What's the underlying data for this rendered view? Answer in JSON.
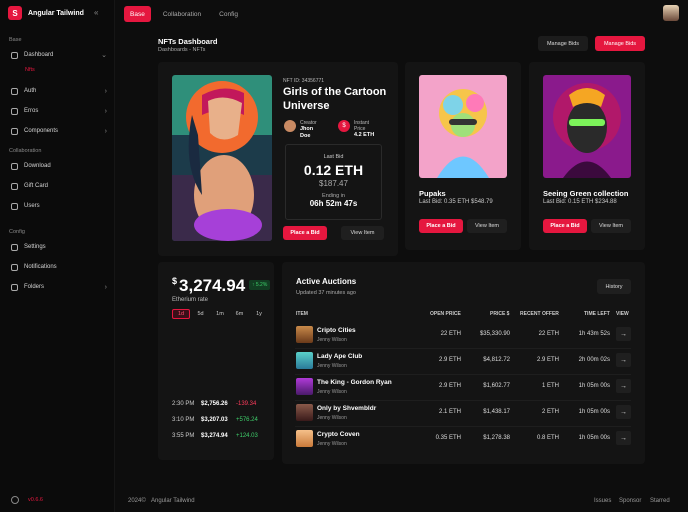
{
  "app": {
    "name": "Angular Tailwind",
    "logo_letter": "S",
    "version": "v0.6.6",
    "accent": "#e5173f"
  },
  "sidebar": {
    "sections": [
      {
        "title": "Base"
      },
      {
        "title": "Collaboration"
      },
      {
        "title": "Config"
      }
    ],
    "items": [
      {
        "label": "Dashboard"
      },
      {
        "label": "Auth"
      },
      {
        "label": "Erros"
      },
      {
        "label": "Components"
      },
      {
        "label": "Download"
      },
      {
        "label": "Gift Card"
      },
      {
        "label": "Users"
      },
      {
        "label": "Settings"
      },
      {
        "label": "Notifications"
      },
      {
        "label": "Folders"
      }
    ],
    "subitem": "Nfts"
  },
  "topbar": {
    "tabs": [
      "Base",
      "Collaboration",
      "Config"
    ]
  },
  "page": {
    "title": "NFTs Dashboard",
    "breadcrumb": "Dashboards  -  NFTs",
    "manage_bids_1": "Manage Bids",
    "manage_bids_2": "Manage Bids"
  },
  "featured": {
    "nft_id": "NFT ID: 34356771",
    "title": "Girls of the Cartoon Universe",
    "creator_label": "Creator",
    "creator_name": "Jhon Doe",
    "price_label": "Instant Price",
    "price_value": "4.2 ETH",
    "last_bid_label": "Last Bid",
    "last_bid_eth": "0.12 ETH",
    "last_bid_usd": "$187.47",
    "ending_label": "Ending in",
    "ending_value": "06h 52m 47s",
    "place_bid": "Place a Bid",
    "view_item": "View Item"
  },
  "cards": [
    {
      "title": "Pupaks",
      "sub": "Last Bid: 0.35 ETH $548.79",
      "place_bid": "Place a Bid",
      "view_item": "View Item"
    },
    {
      "title": "Seeing Green collection",
      "sub": "Last Bid: 0.15 ETH $234.88",
      "place_bid": "Place a Bid",
      "view_item": "View Item"
    }
  ],
  "eth": {
    "currency": "$",
    "price": "3,274.94",
    "change": "↑ 5.2%",
    "label": "Etherium rate",
    "ranges": [
      "1d",
      "5d",
      "1m",
      "6m",
      "1y"
    ],
    "history": [
      {
        "time": "2:30 PM",
        "price": "$2,756.26",
        "change": "-139.34"
      },
      {
        "time": "3:10 PM",
        "price": "$3,207.03",
        "change": "+576.24"
      },
      {
        "time": "3:55 PM",
        "price": "$3,274.94",
        "change": "+124.03"
      }
    ]
  },
  "auctions": {
    "title": "Active Auctions",
    "updated": "Updated 37 minutes ago",
    "history_btn": "History",
    "headers": [
      "ITEM",
      "OPEN PRICE",
      "PRICE $",
      "RECENT OFFER",
      "TIME LEFT",
      "VIEW"
    ],
    "rows": [
      {
        "name": "Cripto Cities",
        "user": "Jenny Wilson",
        "open": "22 ETH",
        "price": "$35,330.90",
        "offer": "22 ETH",
        "time": "1h 43m 52s"
      },
      {
        "name": "Lady Ape Club",
        "user": "Jenny Wilson",
        "open": "2.9 ETH",
        "price": "$4,812.72",
        "offer": "2.9 ETH",
        "time": "2h 00m 02s"
      },
      {
        "name": "The King - Gordon Ryan",
        "user": "Jenny Wilson",
        "open": "2.9 ETH",
        "price": "$1,602.77",
        "offer": "1 ETH",
        "time": "1h 05m 00s"
      },
      {
        "name": "Only by Shvembldr",
        "user": "Jenny Wilson",
        "open": "2.1 ETH",
        "price": "$1,438.17",
        "offer": "2 ETH",
        "time": "1h 05m 00s"
      },
      {
        "name": "Crypto Coven",
        "user": "Jenny Wilson",
        "open": "0.35 ETH",
        "price": "$1,278.38",
        "offer": "0.8 ETH",
        "time": "1h 05m 00s"
      }
    ],
    "view_glyph": "→"
  },
  "footer": {
    "year": "2024©",
    "brand": "Angular Tailwind",
    "links": [
      "Issues",
      "Sponsor",
      "Starred"
    ]
  }
}
